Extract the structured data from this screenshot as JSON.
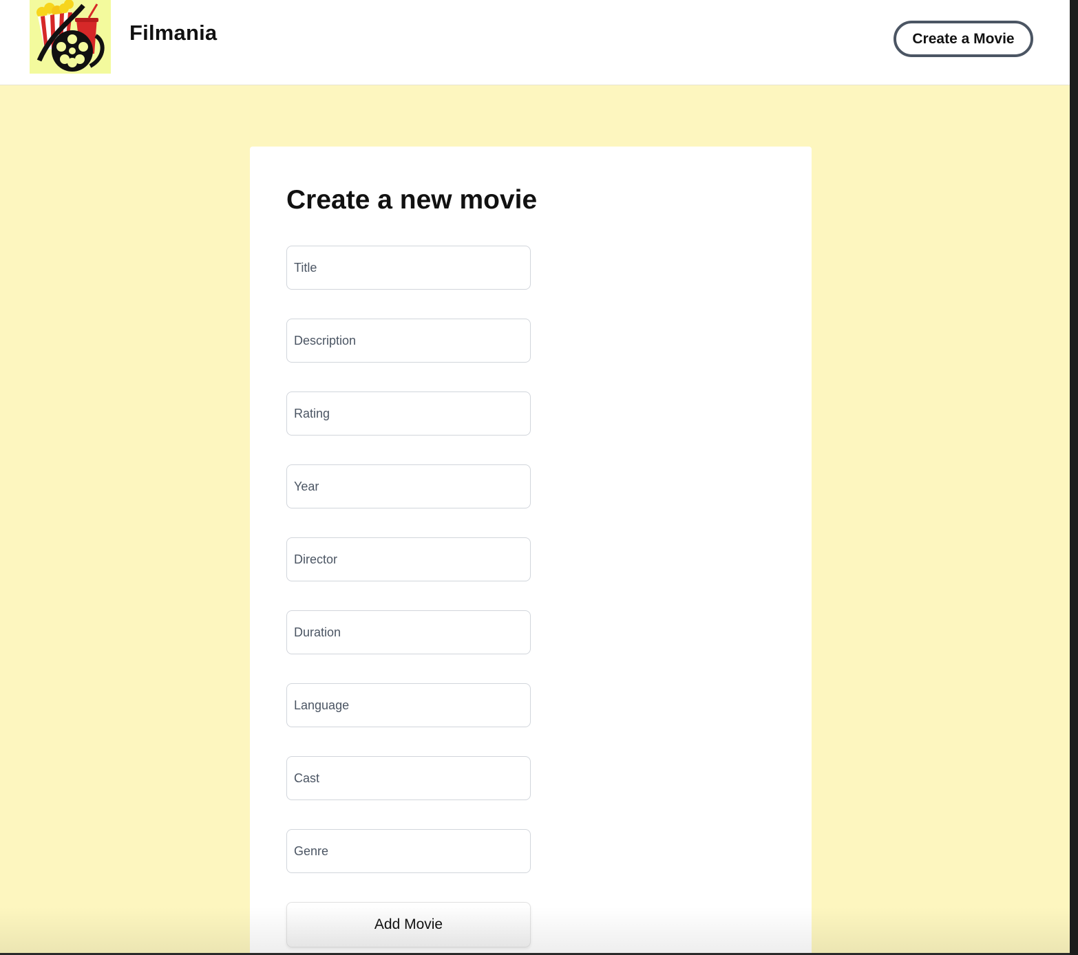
{
  "header": {
    "logo_icon": "popcorn-film-reel-logo",
    "brand": "Filmania",
    "create_button": "Create a Movie"
  },
  "form": {
    "title": "Create a new movie",
    "fields": [
      {
        "name": "title",
        "placeholder": "Title",
        "value": ""
      },
      {
        "name": "description",
        "placeholder": "Description",
        "value": ""
      },
      {
        "name": "rating",
        "placeholder": "Rating",
        "value": ""
      },
      {
        "name": "year",
        "placeholder": "Year",
        "value": ""
      },
      {
        "name": "director",
        "placeholder": "Director",
        "value": ""
      },
      {
        "name": "duration",
        "placeholder": "Duration",
        "value": ""
      },
      {
        "name": "language",
        "placeholder": "Language",
        "value": ""
      },
      {
        "name": "cast",
        "placeholder": "Cast",
        "value": ""
      },
      {
        "name": "genre",
        "placeholder": "Genre",
        "value": ""
      }
    ],
    "submit_label": "Add Movie"
  },
  "colors": {
    "page_background": "#fdf6bf",
    "logo_background": "#f3fa9d",
    "button_border": "#4b5563"
  }
}
